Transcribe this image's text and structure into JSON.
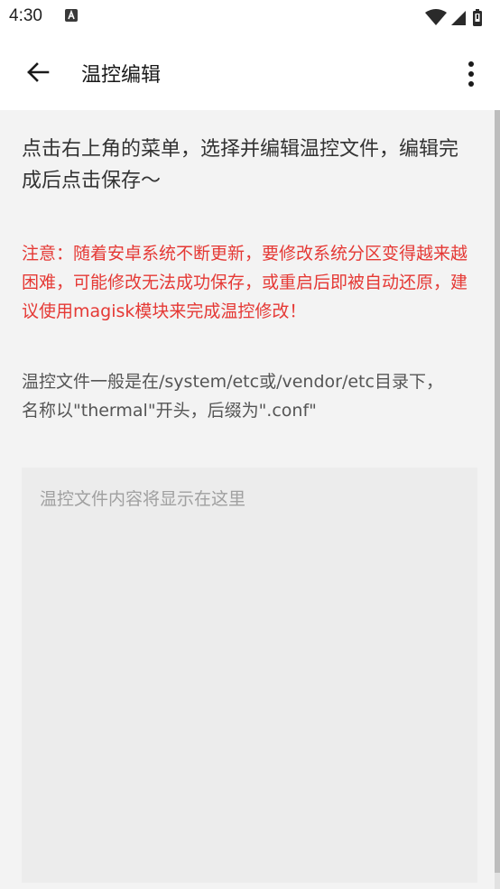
{
  "status_bar": {
    "time": "4:30",
    "icons": [
      "a-notification-icon",
      "wifi-icon",
      "signal-icon",
      "battery-icon"
    ]
  },
  "app_bar": {
    "title": "温控编辑",
    "back_icon": "arrow-left-icon",
    "menu_icon": "more-vertical-icon"
  },
  "main": {
    "intro": "点击右上角的菜单，选择并编辑温控文件，编辑完成后点击保存～",
    "warning": "注意：随着安卓系统不断更新，要修改系统分区变得越来越困难，可能修改无法成功保存，或重启后即被自动还原，建议使用magisk模块来完成温控修改！",
    "info": "温控文件一般是在/system/etc或/vendor/etc目录下，名称以\"thermal\"开头，后缀为\".conf\"",
    "editor_placeholder": "温控文件内容将显示在这里",
    "editor_value": ""
  },
  "colors": {
    "warning": "#e53935",
    "background": "#f3f3f3",
    "editor_bg": "#ececec"
  }
}
